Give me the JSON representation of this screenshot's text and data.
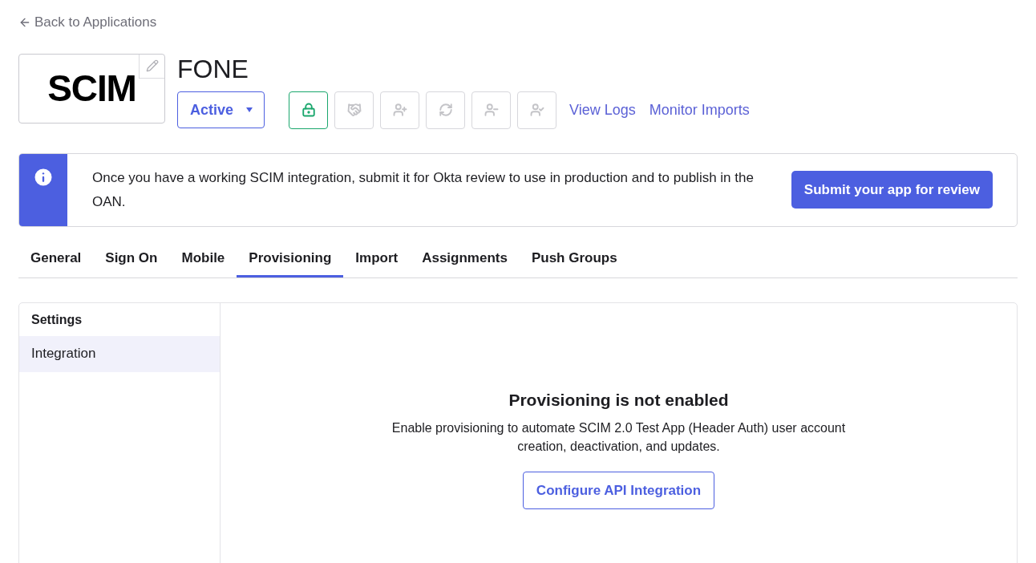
{
  "back_link": {
    "label": "Back to Applications"
  },
  "app": {
    "logo_text": "SCIM",
    "title": "FONE",
    "status": "Active"
  },
  "toolbar_icons": [
    {
      "kind": "lock",
      "active": true
    },
    {
      "kind": "handshake",
      "active": false
    },
    {
      "kind": "user-in",
      "active": false
    },
    {
      "kind": "refresh",
      "active": false
    },
    {
      "kind": "user-out",
      "active": false
    },
    {
      "kind": "user-check",
      "active": false
    }
  ],
  "header_links": [
    "View Logs",
    "Monitor Imports"
  ],
  "banner": {
    "message": "Once you have a working SCIM integration, submit it for Okta review to use in production and to publish in the OAN.",
    "button": "Submit your app for review"
  },
  "tabs": [
    {
      "label": "General",
      "selected": false
    },
    {
      "label": "Sign On",
      "selected": false
    },
    {
      "label": "Mobile",
      "selected": false
    },
    {
      "label": "Provisioning",
      "selected": true
    },
    {
      "label": "Import",
      "selected": false
    },
    {
      "label": "Assignments",
      "selected": false
    },
    {
      "label": "Push Groups",
      "selected": false
    }
  ],
  "sidebar": {
    "heading": "Settings",
    "items": [
      {
        "label": "Integration",
        "selected": true
      }
    ]
  },
  "empty_state": {
    "title": "Provisioning is not enabled",
    "description": "Enable provisioning to automate SCIM 2.0 Test App (Header Auth) user account creation, deactivation, and updates.",
    "button": "Configure API Integration"
  }
}
